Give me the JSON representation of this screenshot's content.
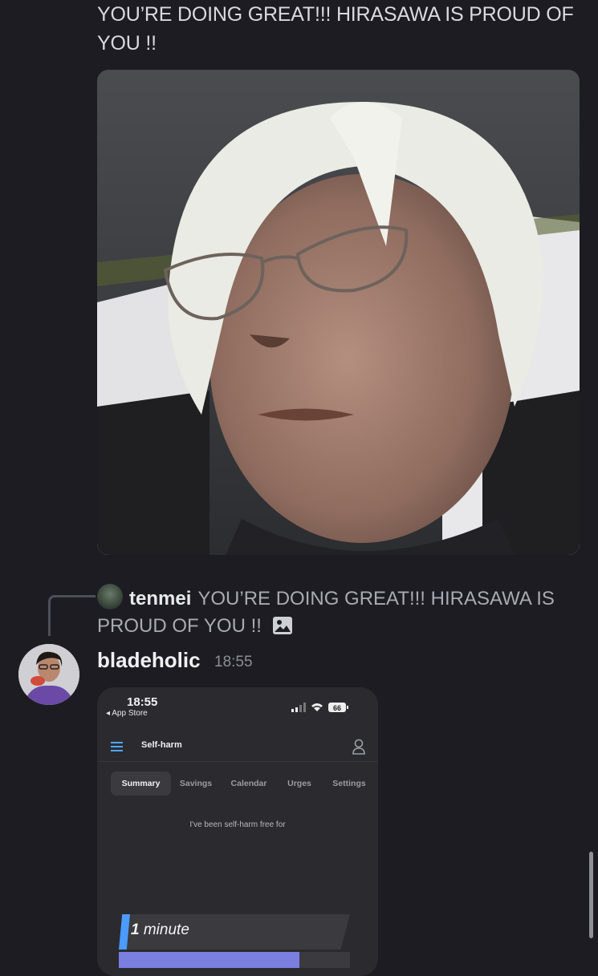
{
  "message": {
    "text": "YOU’RE DOING GREAT!!! HIRASAWA IS PROUD OF YOU !!"
  },
  "reply": {
    "name": "tenmei",
    "text": "YOU’RE DOING GREAT!!! HIRASAWA IS PROUD OF YOU !!",
    "attachment_icon": "image-icon"
  },
  "post": {
    "author": "bladeholic",
    "time": "18:55"
  },
  "phone": {
    "status_time": "18:55",
    "back_label": "◂ App Store",
    "battery": "66",
    "nav_title": "Self-harm",
    "tabs": [
      "Summary",
      "Savings",
      "Calendar",
      "Urges",
      "Settings"
    ],
    "active_tab": "Summary",
    "free_label": "I've been self-harm free for",
    "counter_value": "1",
    "counter_unit": "minute",
    "progress_fraction": 0.78,
    "accent_color": "#4c9bff",
    "progress_color": "#7b7fe0"
  }
}
